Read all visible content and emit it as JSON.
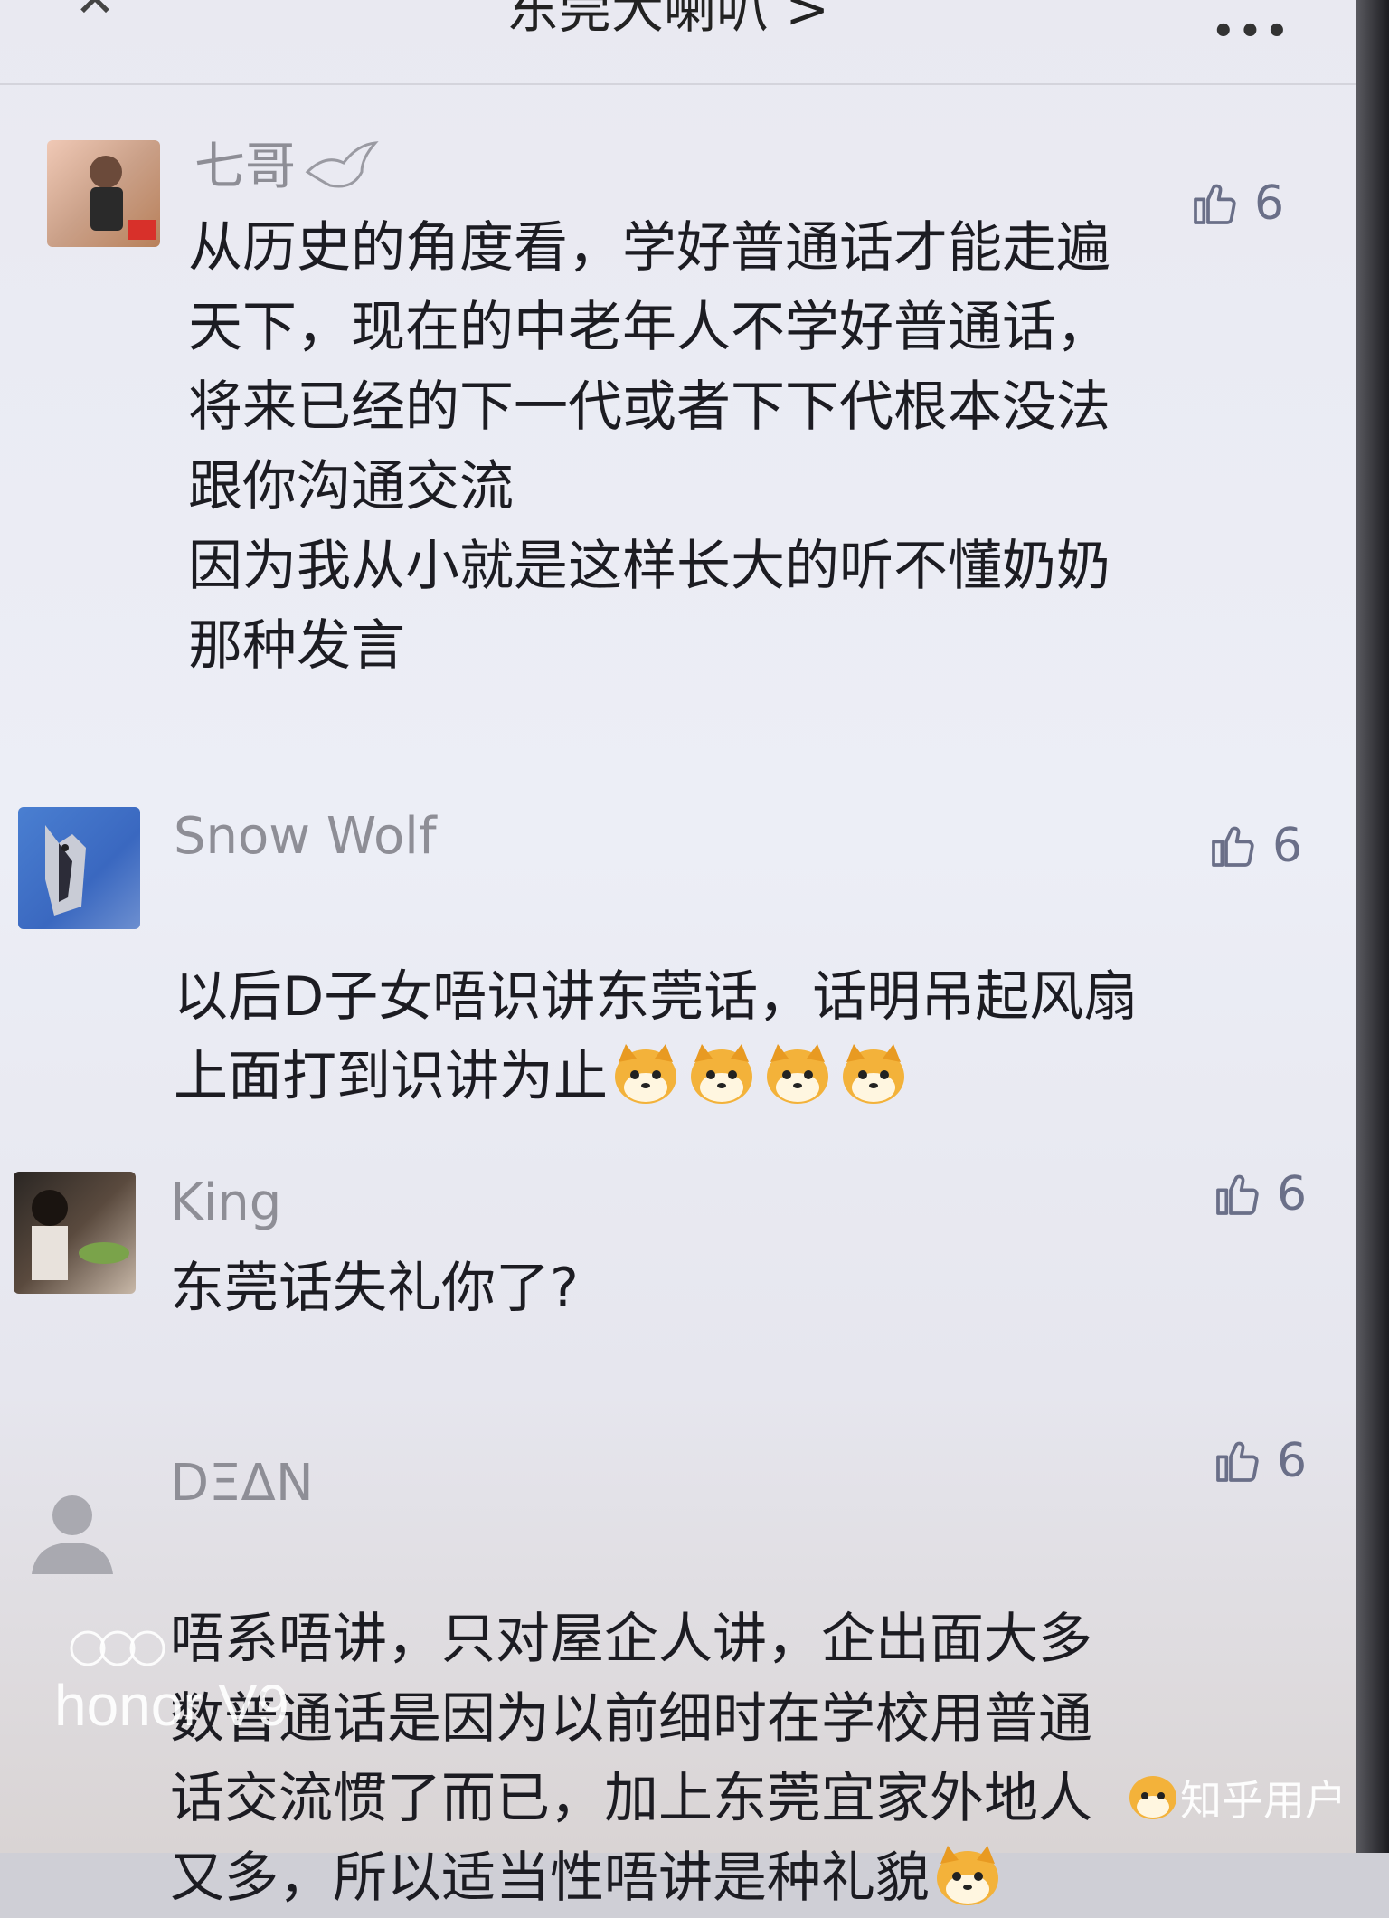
{
  "header": {
    "title": "东莞大喇叭 >",
    "close_icon": "close-icon",
    "more_icon": "more-icon"
  },
  "comments": [
    {
      "user": "七哥",
      "likes": "6",
      "text": "从历史的角度看，学好普通话才能走遍\n天下，现在的中老年人不学好普通话，\n将来已经的下一代或者下下代根本没法\n跟你沟通交流\n因为我从小就是这样长大的听不懂奶奶\n那种发言"
    },
    {
      "user": "Snow Wolf",
      "likes": "6",
      "text": "以后D子女唔识讲东莞话，话明吊起风扇\n上面打到识讲为止"
    },
    {
      "user": "King",
      "likes": "6",
      "text": "东莞话失礼你了?"
    },
    {
      "user": "DΞΔN",
      "likes": "6",
      "text": "唔系唔讲，只对屋企人讲，企出面大多\n数普通话是因为以前细时在学校用普通\n话交流惯了而已，加上东莞宜家外地人\n又多，所以适当性唔讲是种礼貌"
    }
  ],
  "watermark": {
    "brand": "honor V9",
    "source": "知乎用户"
  }
}
